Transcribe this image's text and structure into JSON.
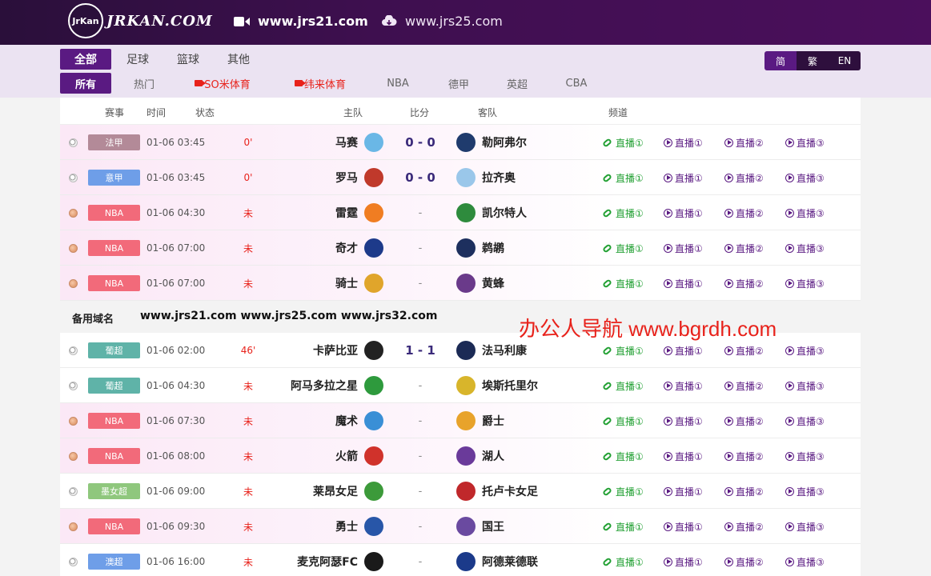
{
  "header": {
    "logo_text": "JRKAN.COM",
    "logo_badge": "JrKan",
    "domain_primary": "www.jrs21.com",
    "domain_secondary": "www.jrs25.com"
  },
  "nav": {
    "tabs_top": [
      "全部",
      "足球",
      "篮球",
      "其他"
    ],
    "tabs_sub": [
      "所有",
      "热门",
      "SO米体育",
      "纬来体育",
      "NBA",
      "德甲",
      "英超",
      "CBA"
    ],
    "lang": [
      "简",
      "繁",
      "EN"
    ]
  },
  "table": {
    "headers": [
      "赛事",
      "时间",
      "状态",
      "主队",
      "比分",
      "客队",
      "频道"
    ]
  },
  "channels": {
    "c1": "直播①",
    "c2": "直播①",
    "c3": "直播②",
    "c4": "直播③"
  },
  "matches_a": [
    {
      "sport": "soccer",
      "league": "法甲",
      "color": "#b38a98",
      "time": "01-06 03:45",
      "status": "0'",
      "home": "马赛",
      "score": "0 - 0",
      "away": "勒阿弗尔",
      "hcolor": "#6ab7e6",
      "acolor": "#1f3b6d",
      "bg": "pink"
    },
    {
      "sport": "soccer",
      "league": "意甲",
      "color": "#6e9ee8",
      "time": "01-06 03:45",
      "status": "0'",
      "home": "罗马",
      "score": "0 - 0",
      "away": "拉齐奥",
      "hcolor": "#c0392b",
      "acolor": "#9ac7ea",
      "bg": "pink"
    },
    {
      "sport": "basket",
      "league": "NBA",
      "color": "#f26a7a",
      "time": "01-06 04:30",
      "status": "未",
      "home": "雷霆",
      "score": "-",
      "away": "凯尔特人",
      "hcolor": "#f07d22",
      "acolor": "#2e8b3d",
      "bg": "pink"
    },
    {
      "sport": "basket",
      "league": "NBA",
      "color": "#f26a7a",
      "time": "01-06 07:00",
      "status": "未",
      "home": "奇才",
      "score": "-",
      "away": "鹈鹕",
      "hcolor": "#1d3a8a",
      "acolor": "#1d2f5e",
      "bg": "pink"
    },
    {
      "sport": "basket",
      "league": "NBA",
      "color": "#f26a7a",
      "time": "01-06 07:00",
      "status": "未",
      "home": "骑士",
      "score": "-",
      "away": "黄蜂",
      "hcolor": "#e0a52b",
      "acolor": "#6a3a8a",
      "bg": "pink"
    }
  ],
  "backup": {
    "label": "备用域名",
    "domains": "www.jrs21.com www.jrs25.com www.jrs32.com"
  },
  "watermark": "办公人导航 www.bgrdh.com",
  "matches_b": [
    {
      "sport": "soccer",
      "league": "葡超",
      "color": "#5fb3a8",
      "time": "01-06 02:00",
      "status": "46'",
      "home": "卡萨比亚",
      "score": "1 - 1",
      "away": "法马利康",
      "hcolor": "#222222",
      "acolor": "#1b2a55",
      "bg": "white"
    },
    {
      "sport": "soccer",
      "league": "葡超",
      "color": "#5fb3a8",
      "time": "01-06 04:30",
      "status": "未",
      "home": "阿马多拉之星",
      "score": "-",
      "away": "埃斯托里尔",
      "hcolor": "#2e9a3d",
      "acolor": "#d8b52b",
      "bg": "white"
    },
    {
      "sport": "basket",
      "league": "NBA",
      "color": "#f26a7a",
      "time": "01-06 07:30",
      "status": "未",
      "home": "魔术",
      "score": "-",
      "away": "爵士",
      "hcolor": "#3a8fd6",
      "acolor": "#e8a32b",
      "bg": "pink"
    },
    {
      "sport": "basket",
      "league": "NBA",
      "color": "#f26a7a",
      "time": "01-06 08:00",
      "status": "未",
      "home": "火箭",
      "score": "-",
      "away": "湖人",
      "hcolor": "#d0322b",
      "acolor": "#6a3a9a",
      "bg": "pink"
    },
    {
      "sport": "soccer",
      "league": "墨女超",
      "color": "#8fc77d",
      "time": "01-06 09:00",
      "status": "未",
      "home": "莱昂女足",
      "score": "-",
      "away": "托卢卡女足",
      "hcolor": "#3c9a3a",
      "acolor": "#c0282b",
      "bg": "white"
    },
    {
      "sport": "basket",
      "league": "NBA",
      "color": "#f26a7a",
      "time": "01-06 09:30",
      "status": "未",
      "home": "勇士",
      "score": "-",
      "away": "国王",
      "hcolor": "#2856a8",
      "acolor": "#6a4aa0",
      "bg": "pink"
    },
    {
      "sport": "soccer",
      "league": "澳超",
      "color": "#6e9ee8",
      "time": "01-06 16:00",
      "status": "未",
      "home": "麦克阿瑟FC",
      "score": "-",
      "away": "阿德莱德联",
      "hcolor": "#1a1a1a",
      "acolor": "#1b3a8a",
      "bg": "white"
    }
  ]
}
